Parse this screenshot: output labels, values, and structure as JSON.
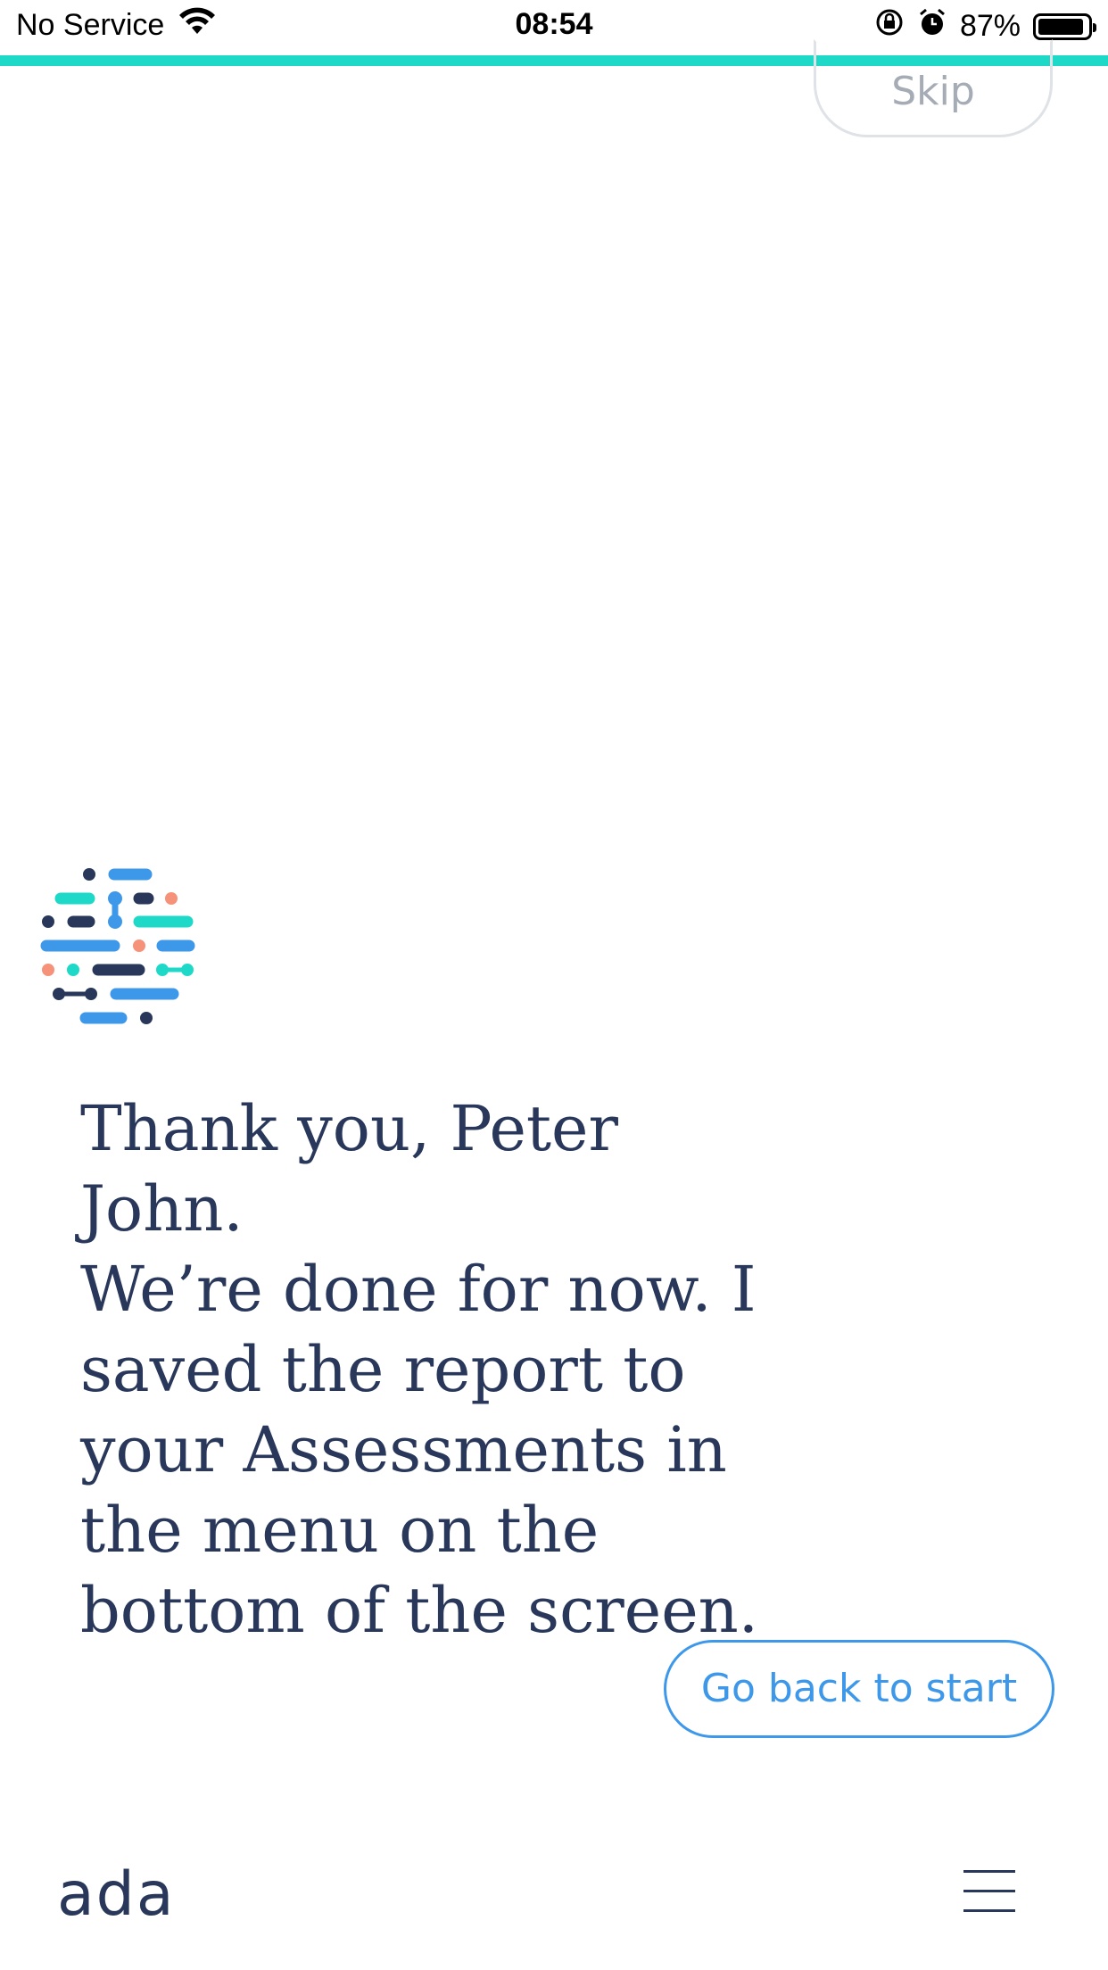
{
  "status_bar": {
    "carrier": "No Service",
    "time": "08:54",
    "battery": "87%"
  },
  "progress": {
    "fraction": 1.0,
    "color": "#1ed9c8"
  },
  "header": {
    "skip_label": "Skip"
  },
  "message": {
    "lines": [
      "Thank you, Peter John.",
      "We’re done for now. I",
      "saved the report to",
      "your Assessments in",
      "the menu on the",
      "bottom of the screen."
    ]
  },
  "actions": {
    "go_back_label": "Go back to start"
  },
  "footer": {
    "brand": "ada",
    "menu_icon": "hamburger-menu-icon"
  },
  "colors": {
    "text": "#28375a",
    "accent": "#3e98ea",
    "teal": "#1ed9c8",
    "coral": "#f6917a",
    "navy": "#28375a"
  }
}
